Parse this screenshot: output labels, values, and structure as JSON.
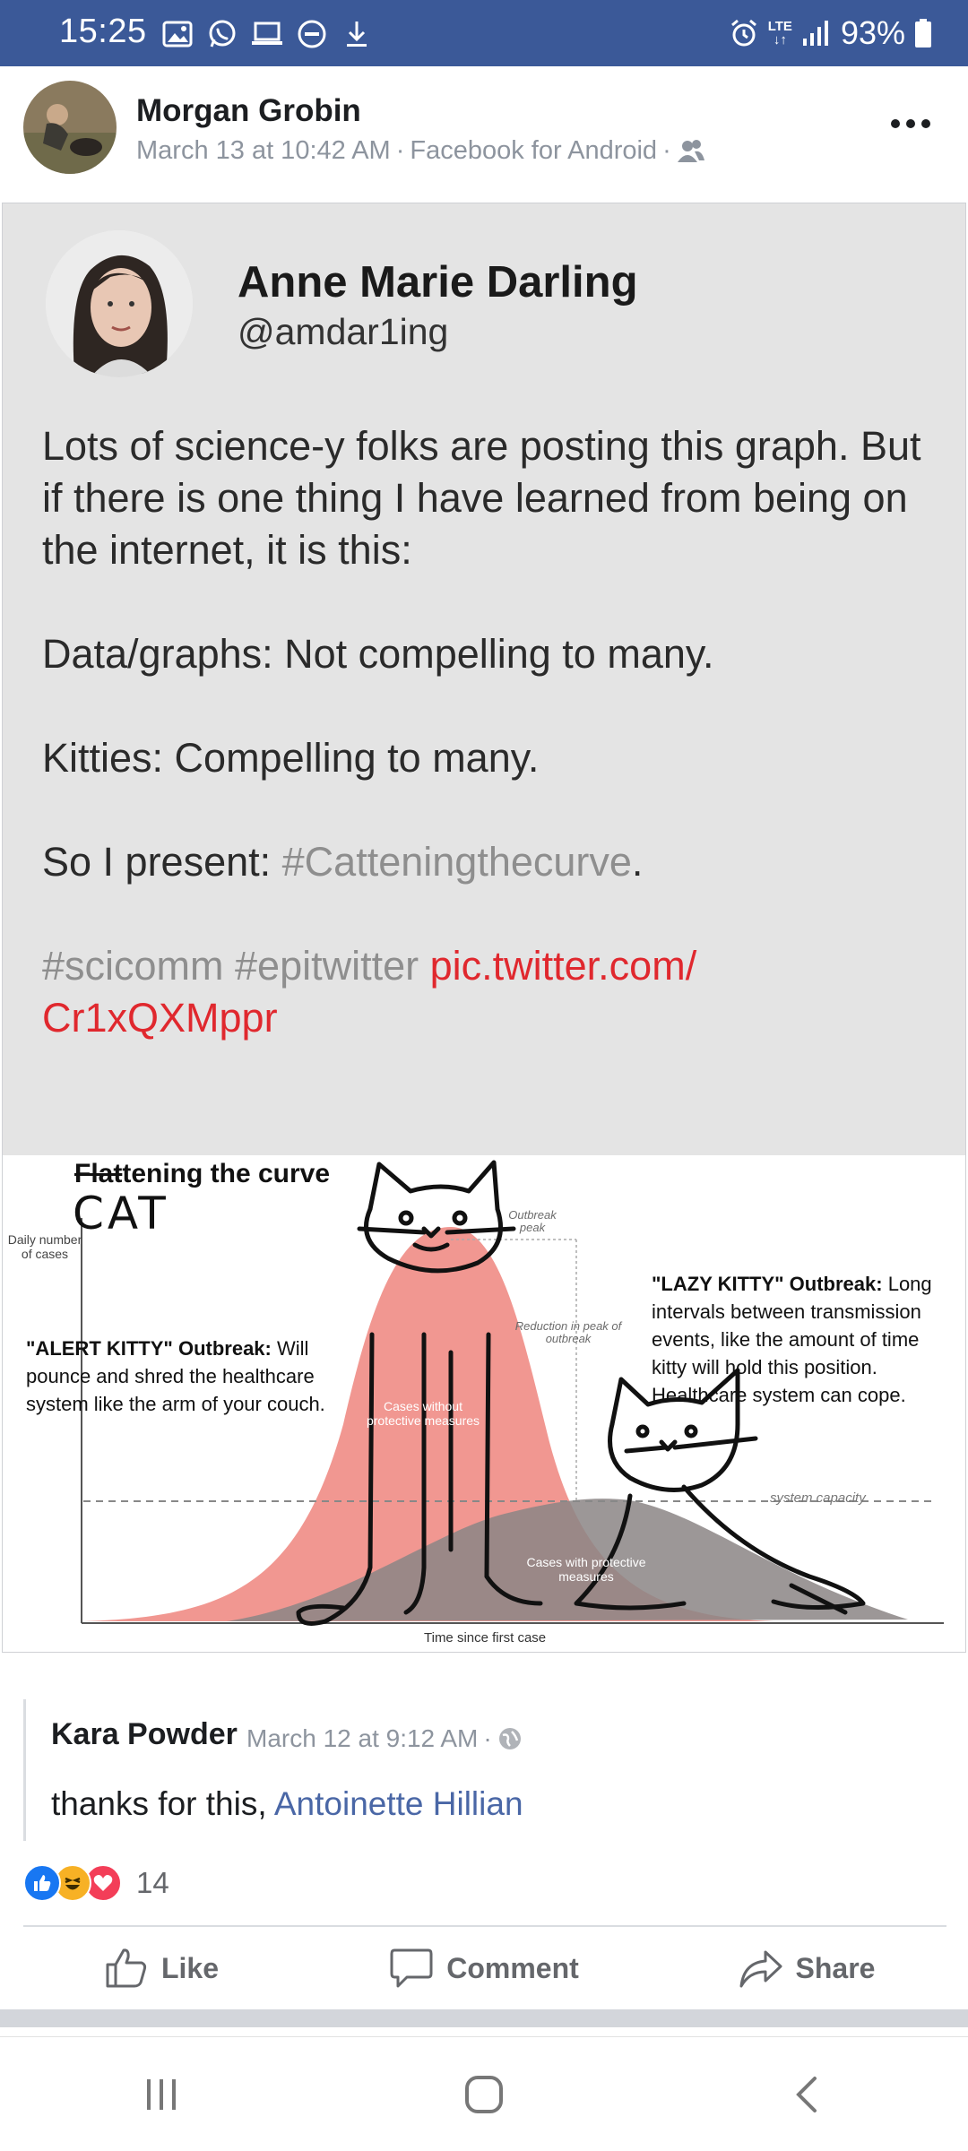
{
  "status_bar": {
    "time": "15:25",
    "network": "LTE",
    "battery": "93%",
    "left_icons": [
      "gallery-icon",
      "whatsapp-icon",
      "laptop-icon",
      "dnd-icon",
      "download-icon"
    ],
    "right_icons": [
      "alarm-icon",
      "lte-icon",
      "signal-icon",
      "battery-icon"
    ]
  },
  "post": {
    "author": "Morgan Grobin",
    "timestamp": "March 13 at 10:42 AM",
    "via": "Facebook for Android",
    "separator": "·",
    "audience_icon": "friends-icon",
    "more_icon": "more-dots-icon"
  },
  "tweet": {
    "name": "Anne Marie Darling",
    "handle": "@amdar1ing",
    "line1": "Lots of science-y folks are posting this graph. But if there is one thing I have learned from being on the internet, it is this:",
    "line2": "Data/graphs: Not compelling to many.",
    "line3": "Kitties: Compelling to many.",
    "line4_prefix": "So I present: ",
    "line4_hashtag": "#Catteningthecurve",
    "line4_suffix": ".",
    "tags": "#scicomm #epitwitter ",
    "link_part1": "pic.twitter.com/",
    "link_part2": "Cr1xQXMppr"
  },
  "graph": {
    "title_struck": "Flat",
    "title_rest": "tening the curve",
    "cat_scribble": "CAT",
    "ylabel": "Daily number of cases",
    "alert_title": "\"ALERT KITTY\" Outbreak:",
    "alert_text": " Will pounce and shred the healthcare system like the arm of your couch.",
    "lazy_title": "\"LAZY KITTY\" Outbreak:",
    "lazy_text": " Long intervals between transmission events, like the amount of time kitty will hold this position. Healthcare system can cope.",
    "reduction_label": "Reduction in peak of outbreak",
    "outbreak_peak_label": "Outbreak peak",
    "without_label": "Cases without protective measures",
    "protect_label": "Cases with protective measures",
    "capacity_label": "system capacity",
    "xlabel": "Time since first case"
  },
  "comment": {
    "author": "Kara Powder",
    "timestamp": "March 12 at 9:12 AM",
    "separator": "·",
    "globe_icon": "globe-icon",
    "text": "thanks for this, ",
    "mention": "Antoinette Hillian"
  },
  "reactions": {
    "types": [
      "like-reaction-icon",
      "haha-reaction-icon",
      "love-reaction-icon"
    ],
    "count": "14"
  },
  "actions": {
    "like": "Like",
    "comment": "Comment",
    "share": "Share"
  },
  "navbar": {
    "recents_icon": "recent-apps-icon",
    "home_icon": "home-icon",
    "back_icon": "back-icon"
  }
}
